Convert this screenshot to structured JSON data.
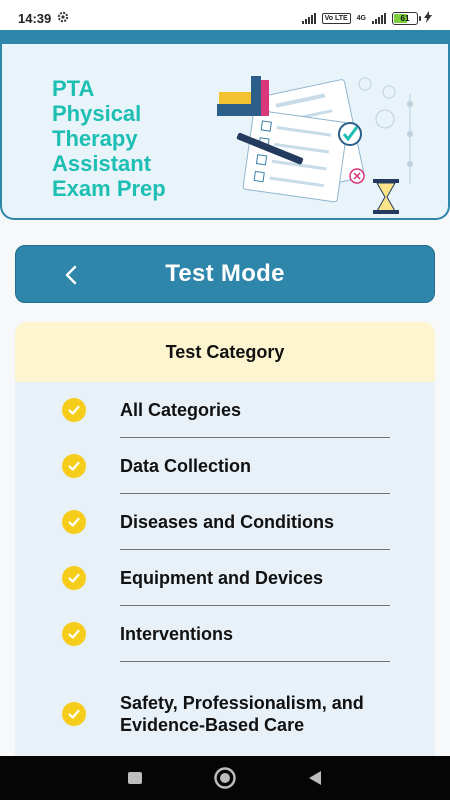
{
  "status_bar": {
    "time": "14:39",
    "network_chip": "Vo LTE",
    "lte_label": "4G",
    "battery_level": "61"
  },
  "header": {
    "app_title_lines": [
      "PTA",
      "Physical",
      "Therapy",
      "Assistant",
      "Exam Prep"
    ],
    "accent_color": "#1dbfb3"
  },
  "nav": {
    "title": "Test Mode",
    "back_icon": "chevron-left-icon",
    "bar_color": "#2e86ab"
  },
  "category": {
    "heading": "Test Category",
    "check_color": "#f6cd1a",
    "items": [
      {
        "label": "All Categories"
      },
      {
        "label": "Data Collection"
      },
      {
        "label": "Diseases and Conditions"
      },
      {
        "label": "Equipment and Devices"
      },
      {
        "label": "Interventions"
      },
      {
        "label": "Safety, Professionalism, and Evidence-Based Care"
      }
    ]
  },
  "system_nav": {
    "recents_icon": "square-icon",
    "home_icon": "circle-home-icon",
    "back_icon": "triangle-back-icon"
  }
}
